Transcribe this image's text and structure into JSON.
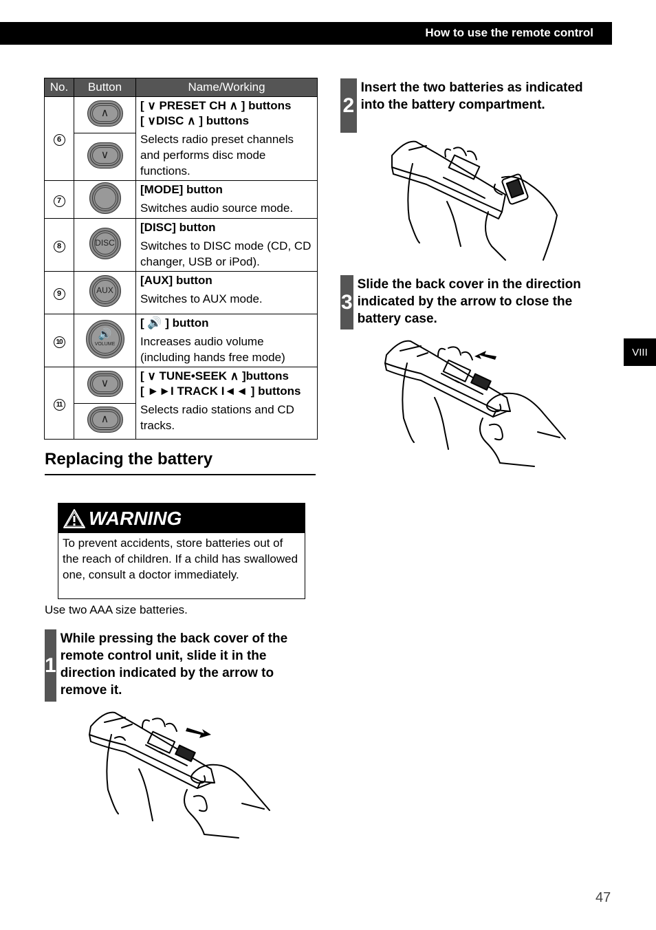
{
  "header": {
    "title": "How to use the remote control"
  },
  "table": {
    "headers": [
      "No.",
      "Button",
      "Name/Working"
    ],
    "rows": [
      {
        "no": "6",
        "buttons": [
          "up-chevron",
          "down-chevron"
        ],
        "names": [
          "[ ∨ PRESET CH ∧ ] buttons",
          "[ ∨DISC ∧ ] buttons"
        ],
        "working": "Selects radio preset channels and performs disc mode functions."
      },
      {
        "no": "7",
        "buttons": [
          "mode"
        ],
        "names": [
          "[MODE] button"
        ],
        "working": "Switches audio source mode."
      },
      {
        "no": "8",
        "buttons": [
          "disc"
        ],
        "button_label": "DISC",
        "names": [
          "[DISC] button"
        ],
        "working": "Switches to DISC mode (CD, CD changer, USB or iPod)."
      },
      {
        "no": "9",
        "buttons": [
          "aux"
        ],
        "button_label": "AUX",
        "names": [
          "[AUX] button"
        ],
        "working": "Switches to AUX mode."
      },
      {
        "no": "10",
        "buttons": [
          "volume"
        ],
        "button_icon": "🔊",
        "button_label": "VOLUME",
        "names": [
          "[ 🔊 ] button"
        ],
        "working": "Increases audio volume (including hands free mode)"
      },
      {
        "no": "11",
        "buttons": [
          "down-chevron",
          "up-chevron"
        ],
        "names": [
          "[ ∨ TUNE•SEEK ∧ ]buttons",
          "[ ►►I TRACK I◄◄ ] buttons"
        ],
        "working": "Selects radio stations and CD tracks."
      }
    ],
    "glyphs": {
      "up": "∧",
      "down": "∨"
    }
  },
  "section": {
    "title": "Replacing the battery"
  },
  "warning": {
    "label": "WARNING",
    "body": "To prevent accidents, store batteries out of the reach of children. If a child has swallowed one, consult a doctor immediately."
  },
  "note": "Use two AAA size batteries.",
  "steps": [
    {
      "num": "1",
      "text": "While pressing the back cover of the remote control unit, slide it in the direction indicated by the arrow to remove it."
    },
    {
      "num": "2",
      "text": "Insert the two batteries as indicated into the battery compartment."
    },
    {
      "num": "3",
      "text": "Slide the back cover in the direction indicated by the arrow to close the battery case."
    }
  ],
  "side_tab": "VIII",
  "page_number": "47"
}
